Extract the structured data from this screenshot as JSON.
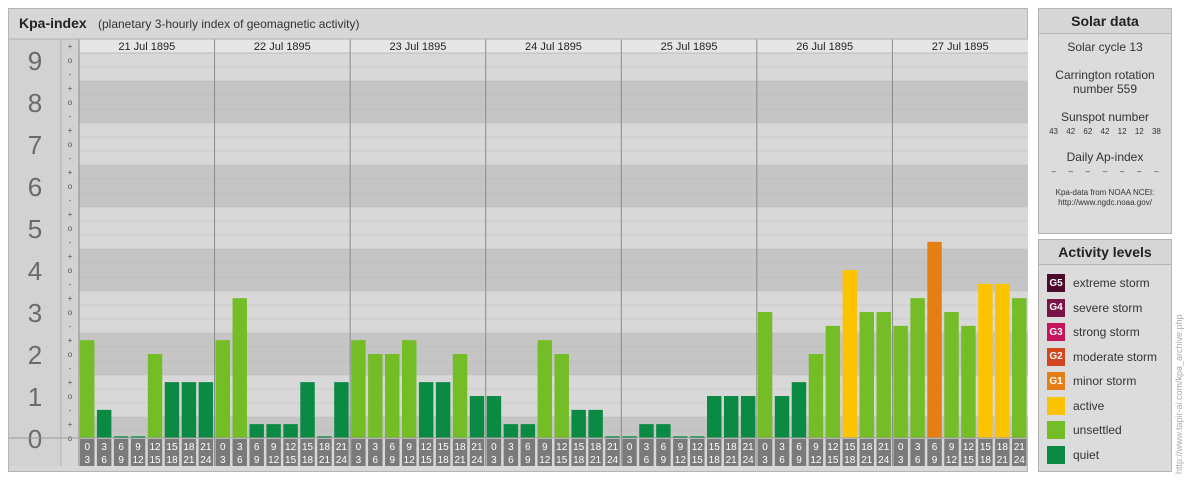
{
  "chart_data": {
    "type": "bar",
    "title": "Kpa-index",
    "subtitle": "(planetary 3-hourly index of geomagnetic activity)",
    "ylim": [
      0,
      9
    ],
    "yticks": [
      "0",
      "1",
      "2",
      "3",
      "4",
      "5",
      "6",
      "7",
      "8",
      "9"
    ],
    "minor_ticks": [
      "o",
      "+",
      "-"
    ],
    "days": [
      "21 Jul 1895",
      "22 Jul 1895",
      "23 Jul 1895",
      "24 Jul 1895",
      "25 Jul 1895",
      "26 Jul 1895",
      "27 Jul 1895"
    ],
    "interval_starts": [
      "0",
      "3",
      "6",
      "9",
      "12",
      "15",
      "18",
      "21"
    ],
    "interval_ends": [
      "3",
      "6",
      "9",
      "12",
      "15",
      "18",
      "21",
      "24"
    ],
    "values": [
      [
        2.33,
        0.67,
        0,
        0,
        2,
        1.33,
        1.33,
        1.33
      ],
      [
        2.33,
        3.33,
        0.33,
        0.33,
        0.33,
        1.33,
        0,
        1.33
      ],
      [
        2.33,
        2,
        2,
        2.33,
        1.33,
        1.33,
        2,
        1
      ],
      [
        1,
        0.33,
        0.33,
        2.33,
        2,
        0.67,
        0.67,
        0
      ],
      [
        0,
        0.33,
        0.33,
        0,
        0,
        1,
        1,
        1
      ],
      [
        3,
        1,
        1.33,
        2,
        2.67,
        4,
        3,
        3
      ],
      [
        2.67,
        3.33,
        4.67,
        3,
        2.67,
        3.67,
        3.67,
        3.33
      ]
    ],
    "level_colors": {
      "quiet": "#0a8a43",
      "unsettled": "#74bd27",
      "active": "#fcc300",
      "minor_storm": "#e67e16",
      "moderate_storm": "#d2461e",
      "strong_storm": "#c3145c",
      "severe_storm": "#7a1446",
      "extreme_storm": "#4d0a2a"
    }
  },
  "solar": {
    "title": "Solar data",
    "cycle": "Solar cycle 13",
    "carrington": "Carrington rotation number 559",
    "sunspot_title": "Sunspot number",
    "sunspot_values": [
      "43",
      "42",
      "62",
      "42",
      "12",
      "12",
      "38"
    ],
    "ap_title": "Daily Ap-index",
    "ap_values": [
      "–",
      "–",
      "–",
      "–",
      "–",
      "–",
      "–"
    ],
    "source_line1": "Kpa-data from NOAA NCEI:",
    "source_line2": "http://www.ngdc.noaa.gov/"
  },
  "levels": {
    "title": "Activity levels",
    "items": [
      {
        "code": "G5",
        "label": "extreme storm",
        "color": "#4d0a2a"
      },
      {
        "code": "G4",
        "label": "severe storm",
        "color": "#7a1446"
      },
      {
        "code": "G3",
        "label": "strong storm",
        "color": "#c3145c"
      },
      {
        "code": "G2",
        "label": "moderate storm",
        "color": "#d2461e"
      },
      {
        "code": "G1",
        "label": "minor storm",
        "color": "#e67e16"
      },
      {
        "code": "",
        "label": "active",
        "color": "#fcc300"
      },
      {
        "code": "",
        "label": "unsettled",
        "color": "#74bd27"
      },
      {
        "code": "",
        "label": "quiet",
        "color": "#0a8a43"
      }
    ]
  },
  "watermark": "http://www.tapir-ai.com/kpa_archive.php"
}
